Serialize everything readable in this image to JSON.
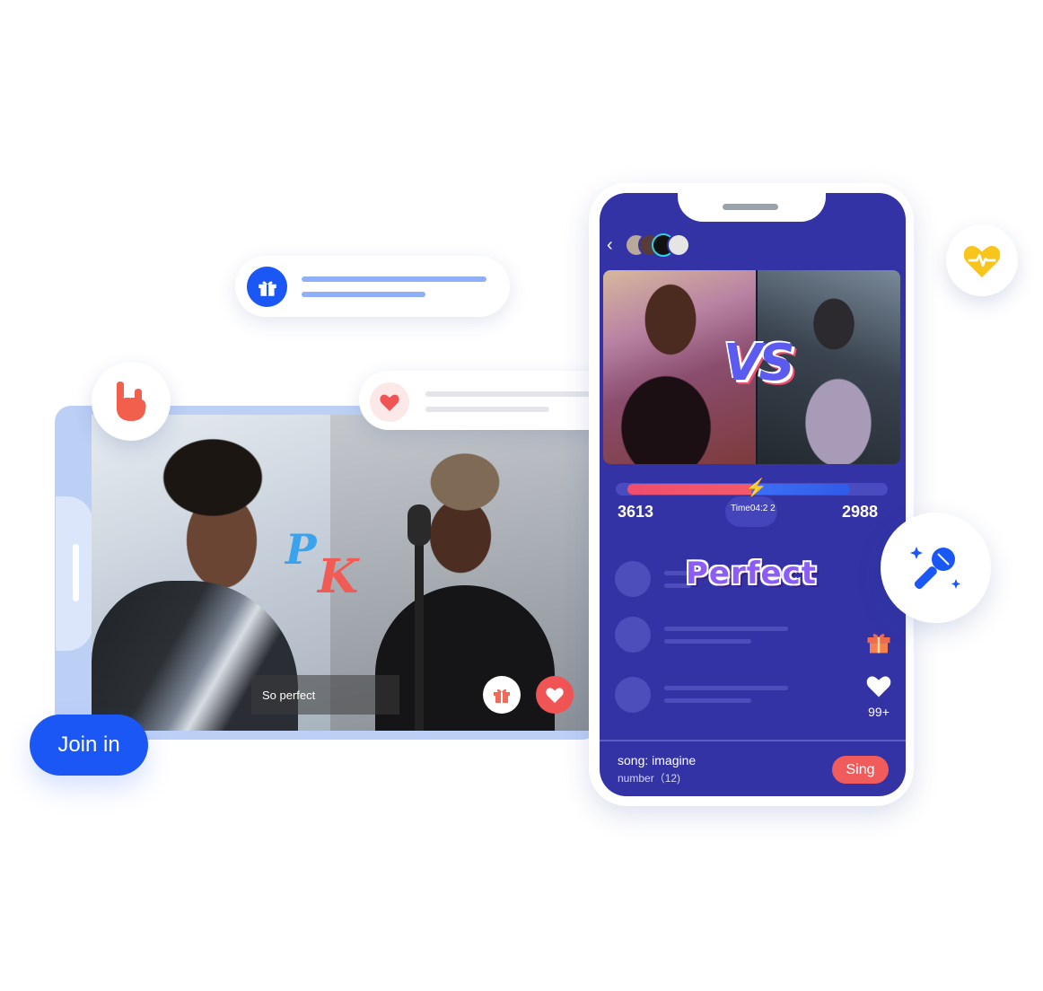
{
  "landscape": {
    "pk_p": "P",
    "pk_k": "K",
    "comment": "So perfect"
  },
  "join_button": {
    "label": "Join in"
  },
  "phone": {
    "score_left": "3613",
    "score_right": "2988",
    "timer": "Time04:2 2",
    "vs": "VS",
    "perfect": "Perfect",
    "like_count": "99+",
    "song": "song: imagine",
    "number": "number（12)",
    "sing_label": "Sing"
  },
  "colors": {
    "brand_blue": "#1a57f5",
    "phone_bg": "#3333a5",
    "accent_red": "#f05b5b",
    "heart_yellow": "#f8c51c"
  },
  "icons": [
    "rock-hand-icon",
    "gift-icon",
    "heart-icon",
    "heartbeat-icon",
    "microphone-icon",
    "back-arrow-icon",
    "lightning-icon"
  ]
}
